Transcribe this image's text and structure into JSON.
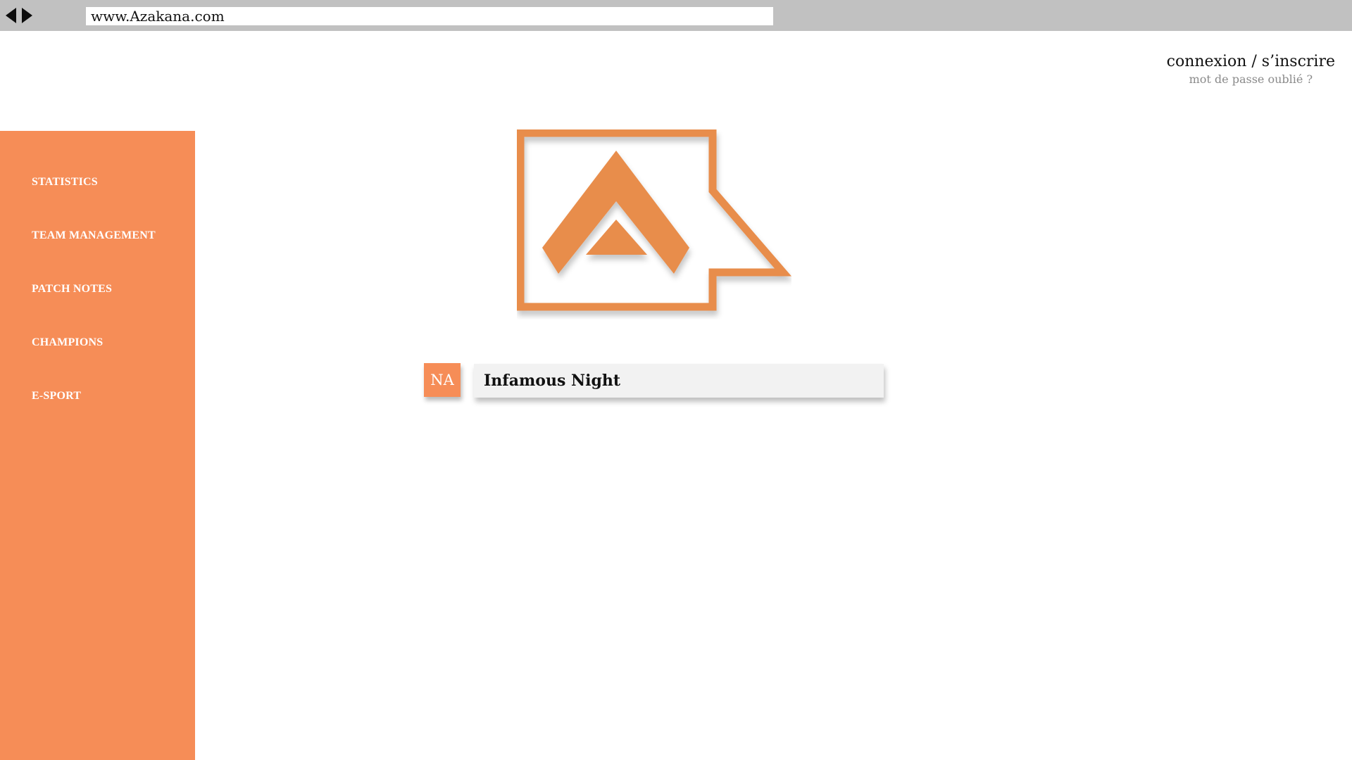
{
  "browser": {
    "url": "www.Azakana.com",
    "back_icon": "triangle-left",
    "forward_icon": "triangle-right"
  },
  "account": {
    "login_label": "connexion / s’inscrire",
    "forgot_label": "mot de passe oublié ?"
  },
  "sidebar": {
    "items": [
      {
        "label": "STATISTICS"
      },
      {
        "label": "TEAM MANAGEMENT"
      },
      {
        "label": "PATCH NOTES"
      },
      {
        "label": "CHAMPIONS"
      },
      {
        "label": "E-SPORT"
      }
    ]
  },
  "search": {
    "region": "NA",
    "summoner_name": "Infamous Night"
  },
  "colors": {
    "accent": "#f68d57",
    "logo": "#e88d4c",
    "browser_bar": "#c1c1c1",
    "field_bg": "#f2f2f2"
  }
}
